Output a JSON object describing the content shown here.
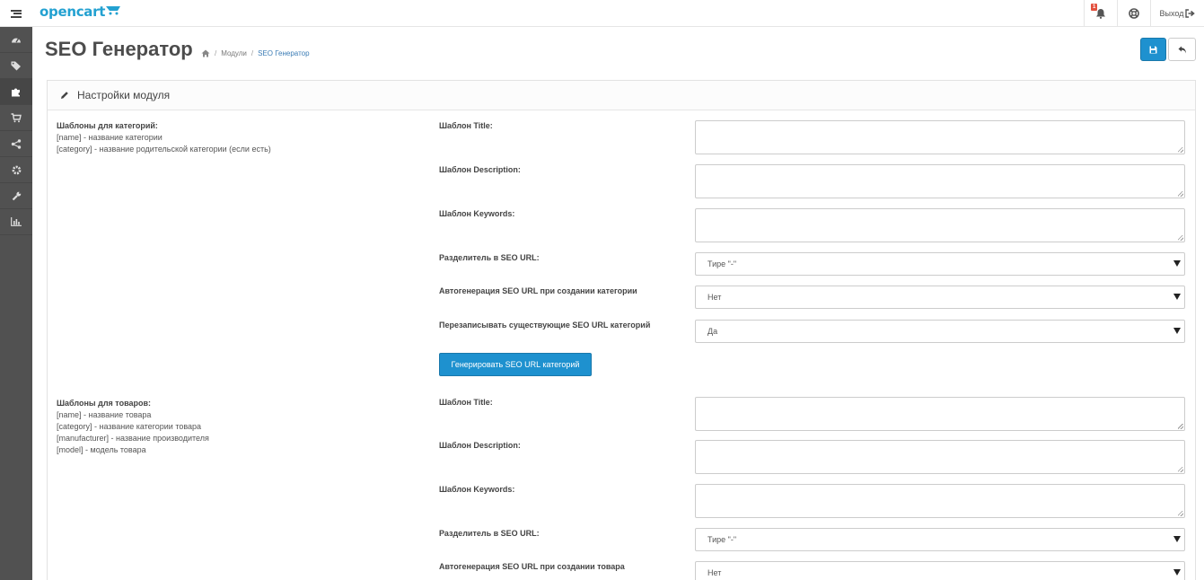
{
  "header": {
    "logo_text": "opencart",
    "notification_count": "1",
    "logout_label": "Выход"
  },
  "sidebar": {
    "items": [
      {
        "icon": "dashboard-icon"
      },
      {
        "icon": "tags-icon"
      },
      {
        "icon": "puzzle-icon",
        "active": true
      },
      {
        "icon": "cart-icon"
      },
      {
        "icon": "share-icon"
      },
      {
        "icon": "cog-icon"
      },
      {
        "icon": "wrench-icon"
      },
      {
        "icon": "bar-chart-icon"
      }
    ]
  },
  "page": {
    "title": "SEO Генератор",
    "breadcrumb": [
      "Модули",
      "SEO Генератор"
    ]
  },
  "panel": {
    "heading": "Настройки модуля"
  },
  "categories": {
    "help_title": "Шаблоны для категорий:",
    "help_lines": [
      "[name] - название категории",
      "[category] - название родительской категории (если есть)"
    ],
    "label_title": "Шаблон Title:",
    "label_description": "Шаблон Description:",
    "label_keywords": "Шаблон Keywords:",
    "label_separator": "Разделитель в SEO URL:",
    "separator_value": "Тире \"-\"",
    "label_autogen": "Автогенерация SEO URL при создании категории",
    "autogen_value": "Нет",
    "label_overwrite": "Перезаписывать существующие SEO URL категорий",
    "overwrite_value": "Да",
    "generate_button": "Генерировать SEO URL категорий"
  },
  "products": {
    "help_title": "Шаблоны для товаров:",
    "help_lines": [
      "[name] - название товара",
      "[category] - название категории товара",
      "[manufacturer] - название производителя",
      "[model] - модель товара"
    ],
    "label_title": "Шаблон Title:",
    "label_description": "Шаблон Description:",
    "label_keywords": "Шаблон Keywords:",
    "label_separator": "Разделитель в SEO URL:",
    "separator_value": "Тире \"-\"",
    "label_autogen": "Автогенерация SEO URL при создании товара",
    "autogen_value": "Нет"
  }
}
